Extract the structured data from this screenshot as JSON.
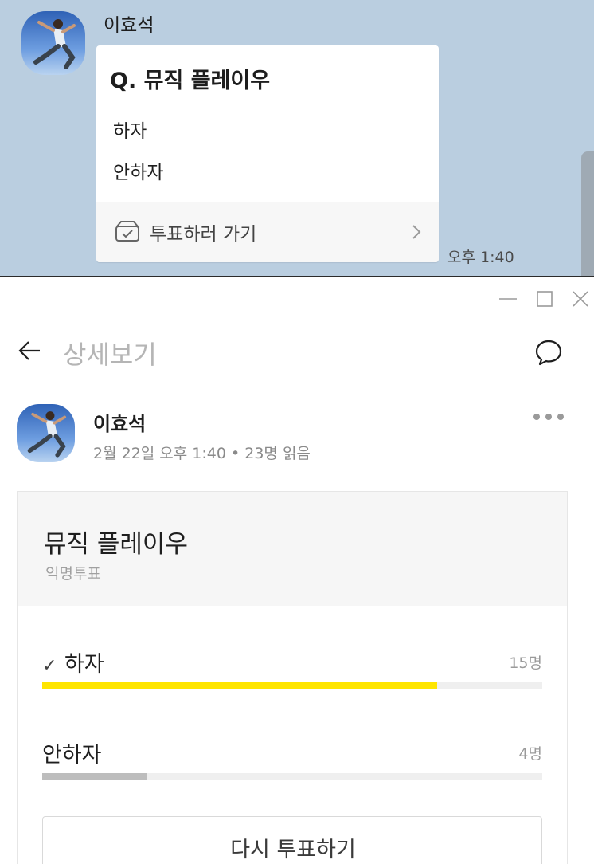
{
  "chat": {
    "sender_name": "이효석",
    "poll_question": "Q. 뮤직 플레이우",
    "poll_options": [
      "하자",
      "안하자"
    ],
    "go_vote_label": "투표하러 가기",
    "time": "오후 1:40",
    "background_color": "#bacee0"
  },
  "window_controls": [
    "minimize-icon",
    "maximize-icon",
    "close-icon"
  ],
  "detail": {
    "title": "상세보기",
    "author": "이효석",
    "meta": "2월 22일 오후 1:40 • 23명 읽음",
    "poll": {
      "title": "뮤직 플레이우",
      "type": "익명투표",
      "options": [
        {
          "label": "하자",
          "count": "15명",
          "votes": 15,
          "fraction": 0.79,
          "voted": true,
          "bar_color": "#fee500"
        },
        {
          "label": "안하자",
          "count": "4명",
          "votes": 4,
          "fraction": 0.21,
          "voted": false,
          "bar_color": "#bdbdbd"
        }
      ],
      "revote_label": "다시 투표하기"
    }
  }
}
